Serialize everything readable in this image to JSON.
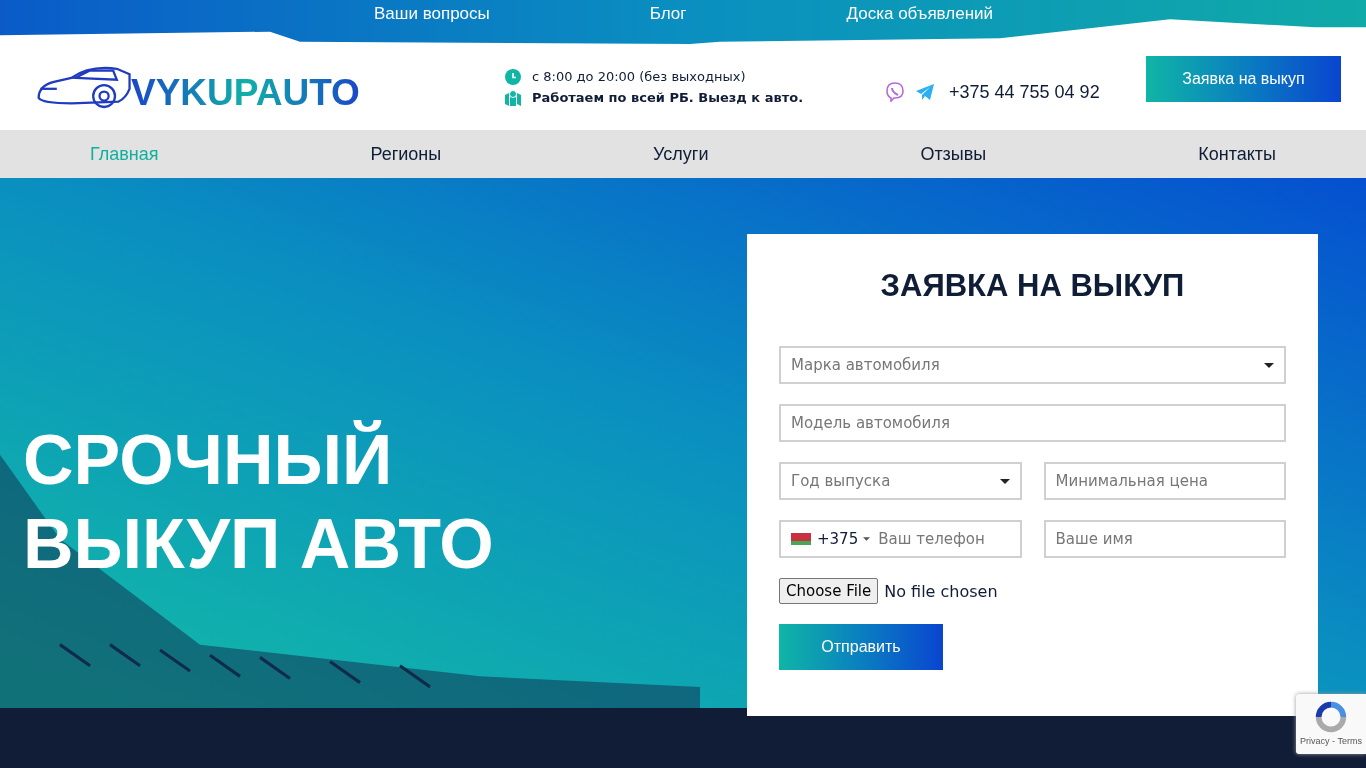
{
  "top_links": [
    "Ваши вопросы",
    "Блог",
    "Доска объявлений"
  ],
  "logo": "VYKUPAUTO",
  "hours": "с 8:00 до 20:00 (без выходных)",
  "coverage": "Работаем по всей РБ. Выезд к авто.",
  "phone": "+375 44 755 04 92",
  "header_button": "Заявка на выкуп",
  "nav": [
    {
      "label": "Главная",
      "selected": true
    },
    {
      "label": "Регионы",
      "selected": false
    },
    {
      "label": "Услуги",
      "selected": false
    },
    {
      "label": "Отзывы",
      "selected": false
    },
    {
      "label": "Контакты",
      "selected": false
    }
  ],
  "hero_title": [
    "СРОЧНЫЙ",
    "ВЫКУП АВТО"
  ],
  "form": {
    "title": "ЗАЯВКА НА ВЫКУП",
    "rows": [
      [
        {
          "kind": "select",
          "placeholder": "Марка автомобиля"
        }
      ],
      [
        {
          "kind": "text",
          "placeholder": "Модель автомобиля"
        }
      ],
      [
        {
          "kind": "select",
          "placeholder": "Год выпуска"
        },
        {
          "kind": "text",
          "placeholder": "Минимальная цена"
        }
      ],
      [
        {
          "kind": "phone",
          "code": "+375",
          "placeholder": "Ваш телефон"
        },
        {
          "kind": "text",
          "placeholder": "Ваше имя"
        }
      ]
    ],
    "file_button": "Choose File",
    "file_status": "No file chosen",
    "submit": "Отправить"
  },
  "recaptcha": "Privacy - Terms"
}
